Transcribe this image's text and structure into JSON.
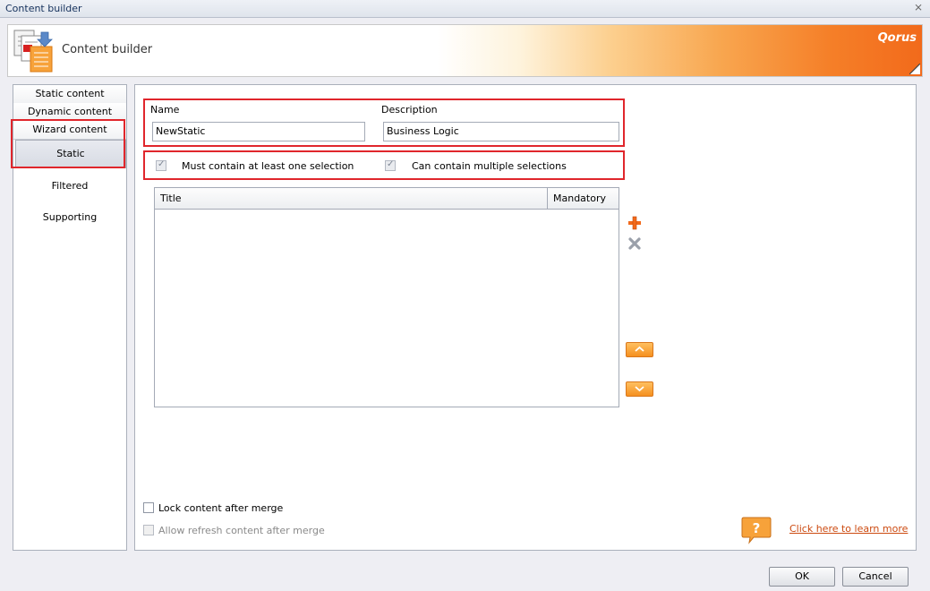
{
  "window": {
    "title": "Content builder",
    "close_glyph": "⨯"
  },
  "banner": {
    "title": "Content builder",
    "logo": "Qorus",
    "icon": "documents-icon"
  },
  "nav": {
    "headers": [
      "Static content",
      "Dynamic content",
      "Wizard content"
    ],
    "items": [
      "Static",
      "Filtered",
      "Supporting"
    ],
    "selected": "Static"
  },
  "form": {
    "name_label": "Name",
    "name_value": "NewStatic",
    "description_label": "Description",
    "description_value": "Business Logic",
    "must_contain_label": "Must contain at least one selection",
    "must_contain_checked": true,
    "multiple_label": "Can contain multiple selections",
    "multiple_checked": true
  },
  "grid": {
    "columns": [
      "Title",
      "Mandatory"
    ],
    "rows": []
  },
  "side_buttons": [
    "add-icon",
    "delete-icon",
    "move-up-icon",
    "move-down-icon"
  ],
  "options": {
    "lock_label": "Lock content after merge",
    "lock_checked": false,
    "refresh_label": "Allow refresh content after merge",
    "refresh_checked": false,
    "refresh_disabled": true
  },
  "help": {
    "link_text": "Click here to learn more",
    "icon": "help-icon"
  },
  "footer": {
    "ok_label": "OK",
    "cancel_label": "Cancel"
  },
  "colors": {
    "accent_orange": "#f26a1b",
    "highlight_red": "#e0262c",
    "link": "#cc4a10"
  }
}
